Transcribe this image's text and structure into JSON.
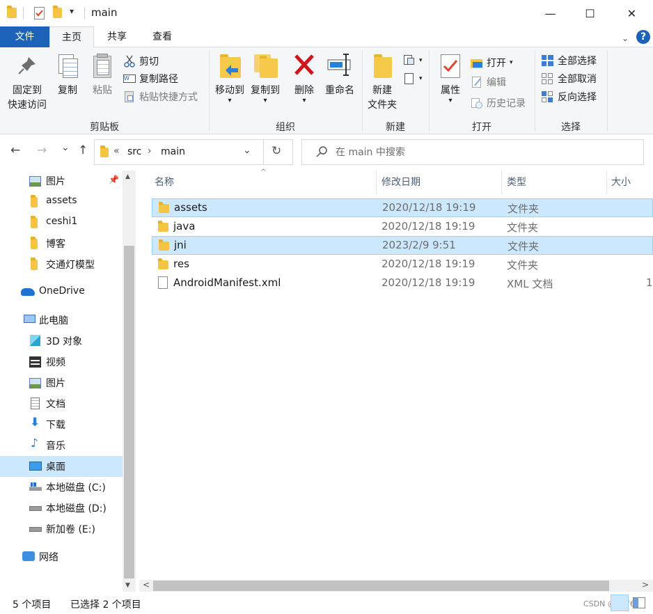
{
  "window": {
    "title": "main",
    "qat_dropdown": "▾",
    "minimize": "—",
    "maximize": "☐",
    "close": "✕"
  },
  "ribbon_tabs": [
    {
      "label": "文件"
    },
    {
      "label": "主页"
    },
    {
      "label": "共享"
    },
    {
      "label": "查看"
    }
  ],
  "help_label": "?",
  "clipboard": {
    "group": "剪贴板",
    "pin_line1": "固定到",
    "pin_line2": "快速访问",
    "copy": "复制",
    "paste": "粘贴",
    "cut": "剪切",
    "copy_path": "复制路径",
    "paste_shortcut": "粘贴快捷方式"
  },
  "organize": {
    "group": "组织",
    "move_to": "移动到",
    "copy_to": "复制到",
    "delete": "删除",
    "rename": "重命名"
  },
  "new": {
    "group": "新建",
    "new_folder_line1": "新建",
    "new_folder_line2": "文件夹"
  },
  "open": {
    "group": "打开",
    "properties": "属性",
    "open": "打开",
    "edit": "编辑",
    "history": "历史记录"
  },
  "select": {
    "group": "选择",
    "select_all": "全部选择",
    "select_none": "全部取消",
    "invert": "反向选择"
  },
  "navigation": {
    "back": "←",
    "forward": "→",
    "recent": "⌄",
    "up": "↑",
    "refresh": "↻"
  },
  "address": {
    "overflow": "«",
    "crumbs": [
      "src",
      "main"
    ],
    "sep": "›"
  },
  "search": {
    "placeholder": "在 main 中搜索"
  },
  "nav_pane": [
    {
      "label": "图片"
    },
    {
      "label": "assets"
    },
    {
      "label": "ceshi1"
    },
    {
      "label": "博客"
    },
    {
      "label": "交通灯模型"
    },
    {
      "label": "OneDrive"
    },
    {
      "label": "此电脑"
    },
    {
      "label": "3D 对象"
    },
    {
      "label": "视频"
    },
    {
      "label": "图片"
    },
    {
      "label": "文档"
    },
    {
      "label": "下载"
    },
    {
      "label": "音乐"
    },
    {
      "label": "桌面"
    },
    {
      "label": "本地磁盘 (C:)"
    },
    {
      "label": "本地磁盘 (D:)"
    },
    {
      "label": "新加卷 (E:)"
    },
    {
      "label": "网络"
    }
  ],
  "columns": {
    "name": "名称",
    "date": "修改日期",
    "type": "类型",
    "size": "大小"
  },
  "files": [
    {
      "name": "assets",
      "date": "2020/12/18 19:19",
      "type": "文件夹",
      "size": "",
      "selected": true,
      "kind": "folder"
    },
    {
      "name": "java",
      "date": "2020/12/18 19:19",
      "type": "文件夹",
      "size": "",
      "selected": false,
      "kind": "folder"
    },
    {
      "name": "jni",
      "date": "2023/2/9 9:51",
      "type": "文件夹",
      "size": "",
      "selected": true,
      "kind": "folder"
    },
    {
      "name": "res",
      "date": "2020/12/18 19:19",
      "type": "文件夹",
      "size": "",
      "selected": false,
      "kind": "folder"
    },
    {
      "name": "AndroidManifest.xml",
      "date": "2020/12/18 19:19",
      "type": "XML 文档",
      "size": "1",
      "selected": false,
      "kind": "file"
    }
  ],
  "status": {
    "count": "5 个项目",
    "selected": "已选择 2 个项目",
    "watermark": "CSDN @u07685"
  },
  "colors": {
    "accent": "#1c62b9",
    "selection": "#cce8ff",
    "selection_border": "#99d1ff",
    "folder": "#f4c542"
  }
}
